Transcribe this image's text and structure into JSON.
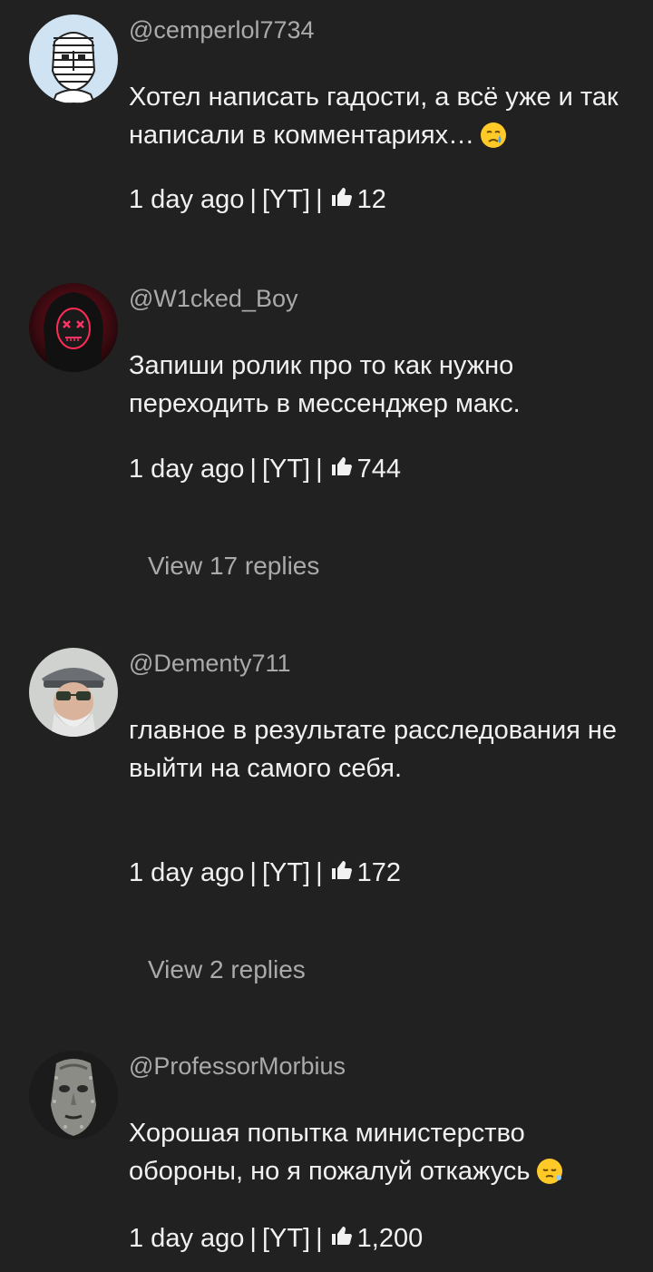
{
  "comments": [
    {
      "author": "@cemperlol7734",
      "text": "Хотел написать гадости, а всё уже и так написали в комментариях…",
      "emoji": "sad-face-emoji",
      "time": "1 day ago",
      "source": "[YT]",
      "likes": "12",
      "replies": ""
    },
    {
      "author": "@W1cked_Boy",
      "text": "Запиши ролик про то как нужно переходить в мессенджер макс.",
      "emoji": "",
      "time": "1 day ago",
      "source": "[YT]",
      "likes": "744",
      "replies": "View 17 replies"
    },
    {
      "author": "@Dementy711",
      "text": "главное в результате расследования не выйти на самого себя.",
      "emoji": "",
      "time": "1 day ago",
      "source": "[YT]",
      "likes": "172",
      "replies": "View 2 replies"
    },
    {
      "author": "@ProfessorMorbius",
      "text": "Хорошая попытка министерство обороны, но я пожалуй откажусь",
      "emoji": "sleepy-face-emoji",
      "time": "1 day ago",
      "source": "[YT]",
      "likes": "1,200",
      "replies": ""
    }
  ],
  "meta_separator": "|",
  "colors": {
    "background": "#212121",
    "primary_text": "#f1f1f1",
    "secondary_text": "#aaaaaa"
  }
}
